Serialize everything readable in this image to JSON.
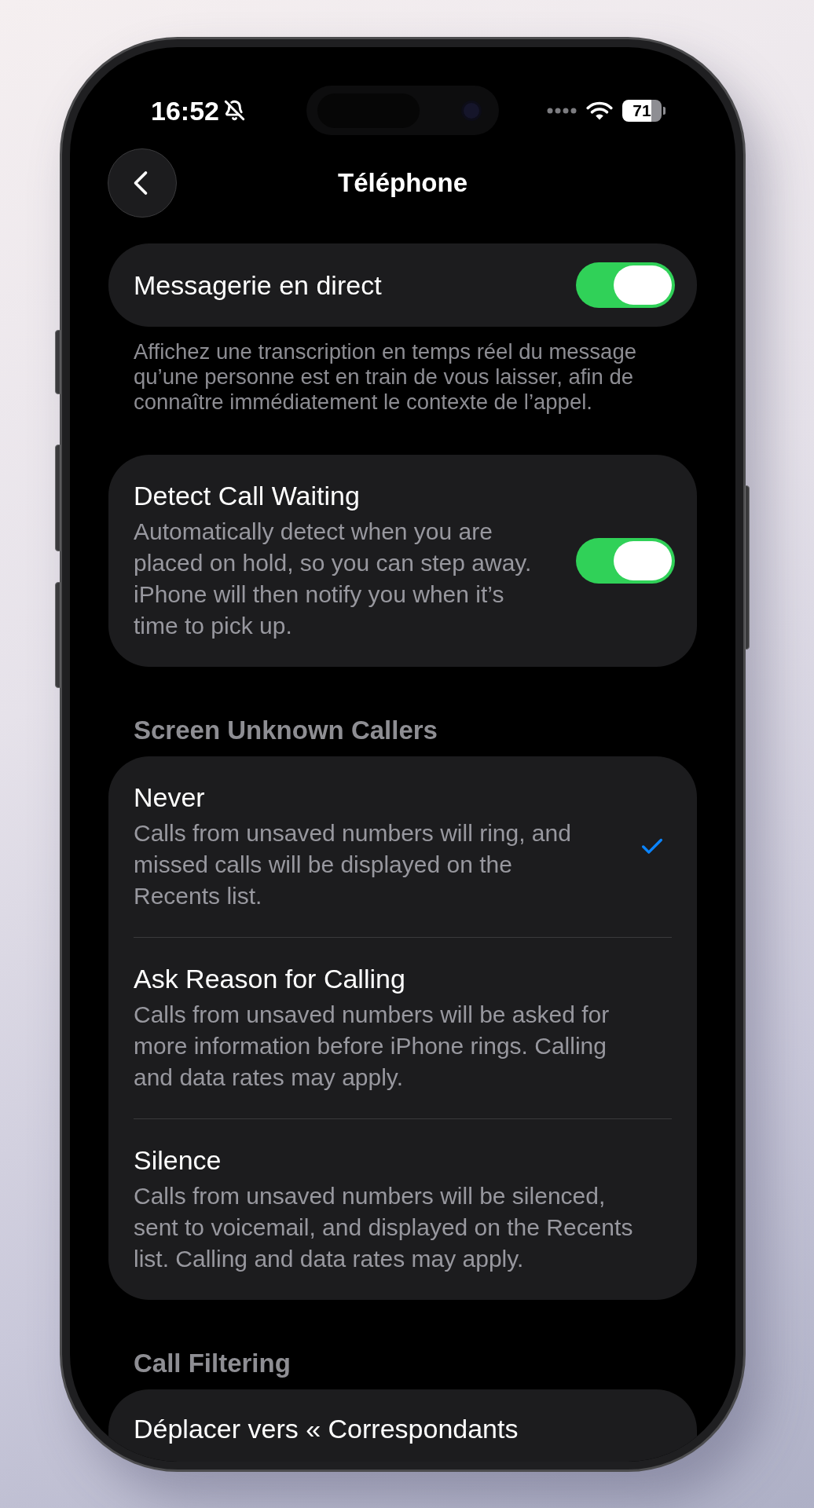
{
  "status_bar": {
    "time": "16:52",
    "battery": "71"
  },
  "header": {
    "title": "Téléphone"
  },
  "groups": [
    {
      "kind": "toggle",
      "rows": [
        {
          "label": "Messagerie en direct",
          "on": true
        }
      ],
      "footer": "Affichez une transcription en temps réel du message qu’une personne est en train de vous laisser, afin de connaître immédiatement le contexte de l’appel."
    },
    {
      "kind": "toggle",
      "rows": [
        {
          "label": "Detect Call Waiting",
          "description": "Automatically detect when you are placed on hold, so you can step away. iPhone will then notify you when it’s time to pick up.",
          "on": true
        }
      ]
    },
    {
      "kind": "choice",
      "header": "Screen Unknown Callers",
      "rows": [
        {
          "label": "Never",
          "description": "Calls from unsaved numbers will ring, and missed calls will be displayed on the Recents list.",
          "selected": true
        },
        {
          "label": "Ask Reason for Calling",
          "description": "Calls from unsaved numbers will be asked for more information before iPhone rings. Calling and data rates may apply.",
          "selected": false
        },
        {
          "label": "Silence",
          "description": "Calls from unsaved numbers will be silenced, sent to voicemail, and displayed on the Recents list. Calling and data rates may apply.",
          "selected": false
        }
      ]
    },
    {
      "kind": "plain",
      "header": "Call Filtering",
      "rows": [
        {
          "label": "Déplacer vers « Correspondants"
        }
      ]
    }
  ]
}
